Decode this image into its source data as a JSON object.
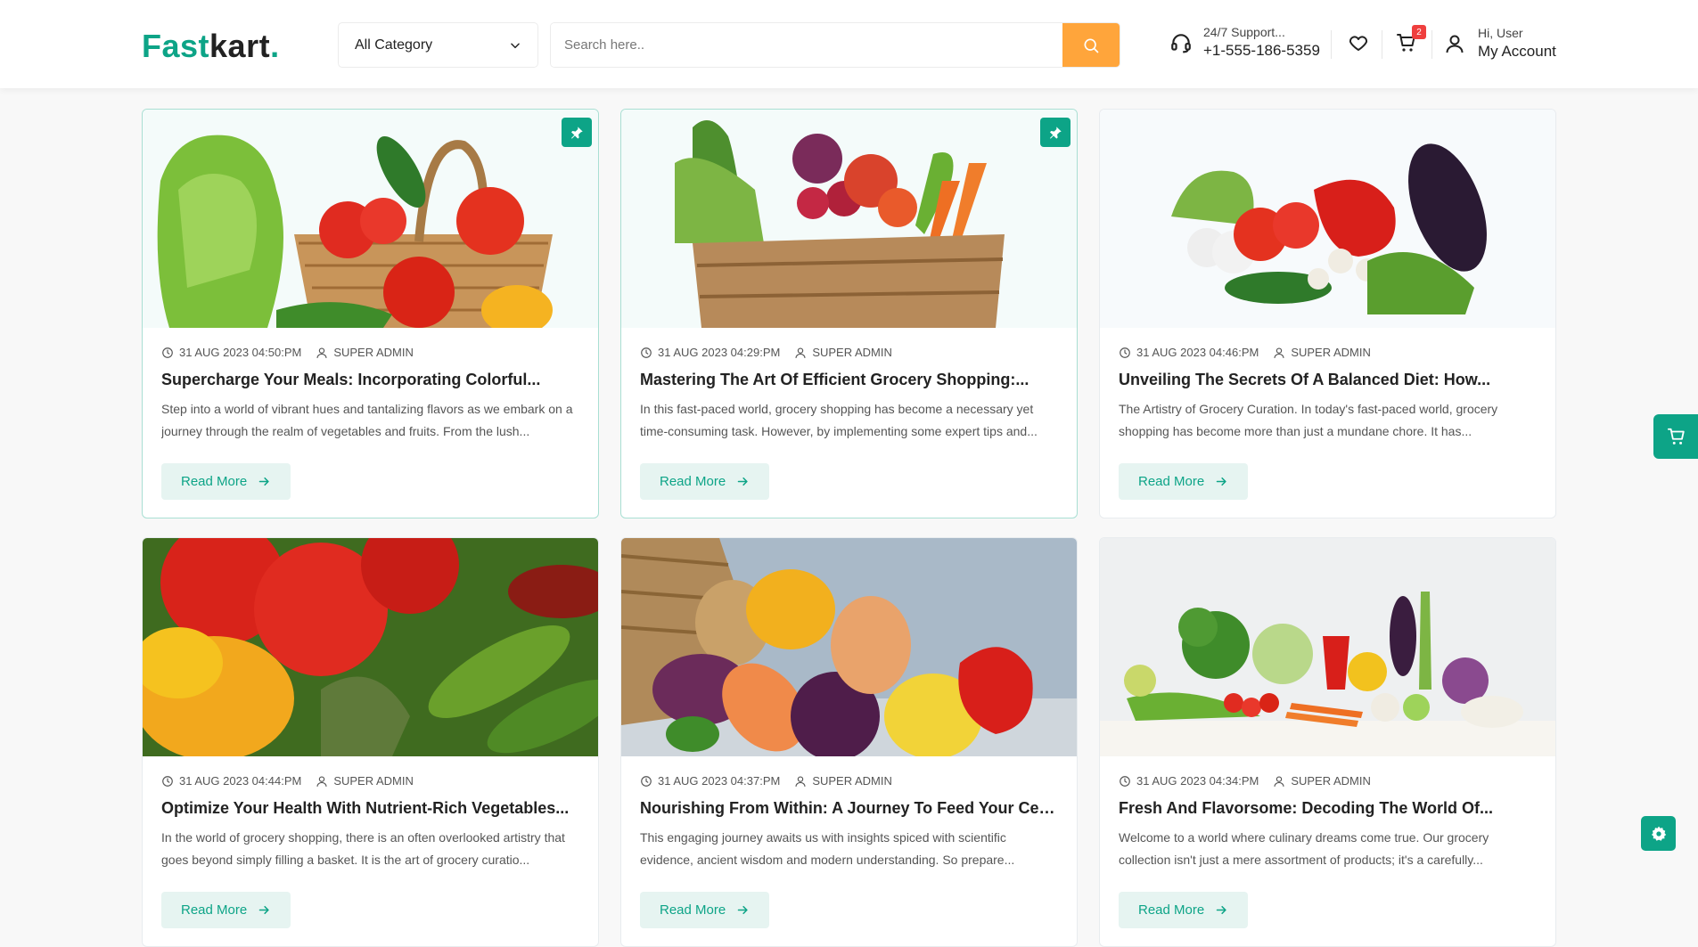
{
  "header": {
    "logo": {
      "part1": "Fast",
      "part2": "kart",
      "dot": "."
    },
    "category": {
      "selected": "All Category",
      "icon": "chevron-down-icon"
    },
    "search": {
      "placeholder": "Search here..",
      "value": "",
      "icon": "search-icon"
    },
    "support": {
      "label": "24/7 Support...",
      "phone": "+1-555-186-5359",
      "icon": "headset-icon"
    },
    "wishlist": {
      "icon": "heart-icon"
    },
    "cart": {
      "icon": "cart-icon",
      "count": "2"
    },
    "account": {
      "greeting": "Hi, User",
      "label": "My Account",
      "icon": "user-icon"
    }
  },
  "colors": {
    "accent": "#0da487",
    "search_button": "#ffa53b",
    "badge": "#ef3f3e"
  },
  "blogs": [
    {
      "date": "31 AUG 2023 04:50:PM",
      "author": "SUPER ADMIN",
      "title": "Supercharge Your Meals: Incorporating Colorful...",
      "excerpt": "Step into a world of vibrant hues and tantalizing flavors as we embark on a journey through the realm of vegetables and fruits. From the lush...",
      "read_more": "Read More",
      "pinned": true
    },
    {
      "date": "31 AUG 2023 04:29:PM",
      "author": "SUPER ADMIN",
      "title": "Mastering The Art Of Efficient Grocery Shopping:...",
      "excerpt": "In this fast-paced world, grocery shopping has become a necessary yet time-consuming task. However, by implementing some expert tips and...",
      "read_more": "Read More",
      "pinned": true
    },
    {
      "date": "31 AUG 2023 04:46:PM",
      "author": "SUPER ADMIN",
      "title": "Unveiling The Secrets Of A Balanced Diet: How...",
      "excerpt": "The Artistry of Grocery Curation. In today's fast-paced world, grocery shopping has become more than just a mundane chore. It has...",
      "read_more": "Read More",
      "pinned": false
    },
    {
      "date": "31 AUG 2023 04:44:PM",
      "author": "SUPER ADMIN",
      "title": "Optimize Your Health With Nutrient-Rich Vegetables...",
      "excerpt": "In the world of grocery shopping, there is an often overlooked artistry that goes beyond simply filling a basket. It is the art of grocery curatio...",
      "read_more": "Read More",
      "pinned": false
    },
    {
      "date": "31 AUG 2023 04:37:PM",
      "author": "SUPER ADMIN",
      "title": "Nourishing From Within: A Journey To Feed Your Cells...",
      "excerpt": "This engaging journey awaits us with insights spiced with scientific evidence, ancient wisdom and modern understanding. So prepare...",
      "read_more": "Read More",
      "pinned": false
    },
    {
      "date": "31 AUG 2023 04:34:PM",
      "author": "SUPER ADMIN",
      "title": "Fresh And Flavorsome: Decoding The World Of...",
      "excerpt": "Welcome to a world where culinary dreams come true. Our grocery collection isn't just a mere assortment of products; it's a carefully...",
      "read_more": "Read More",
      "pinned": false
    }
  ],
  "floating": {
    "cart_icon": "cart-icon",
    "settings_icon": "gear-icon"
  }
}
